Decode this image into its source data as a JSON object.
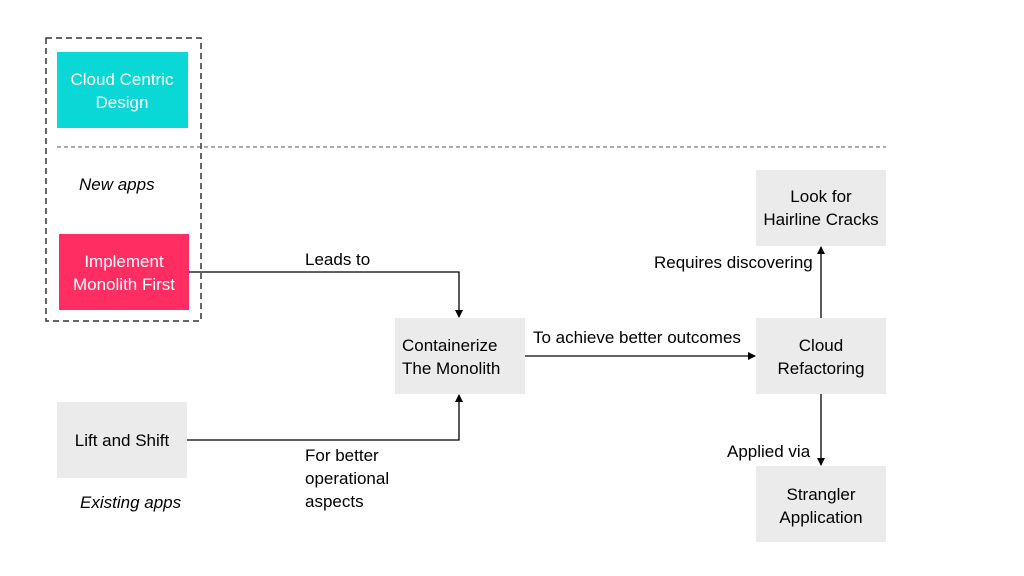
{
  "nodes": {
    "cloud_centric": {
      "lines": [
        "Cloud Centric",
        "Design"
      ],
      "color": "#0ad8d6"
    },
    "implement_monolith": {
      "lines": [
        "Implement",
        "Monolith First"
      ],
      "color": "#ff2d62"
    },
    "containerize": {
      "lines": [
        "Containerize",
        "The Monolith"
      ],
      "color": "#ebebeb"
    },
    "lift_shift": {
      "lines": [
        "Lift and Shift"
      ],
      "color": "#ebebeb"
    },
    "cloud_refactoring": {
      "lines": [
        "Cloud",
        "Refactoring"
      ],
      "color": "#ebebeb"
    },
    "hairline": {
      "lines": [
        "Look for",
        "Hairline Cracks"
      ],
      "color": "#ebebeb"
    },
    "strangler": {
      "lines": [
        "Strangler",
        "Application"
      ],
      "color": "#ebebeb"
    }
  },
  "section_labels": {
    "new_apps": "New apps",
    "existing_apps": "Existing apps"
  },
  "edges": {
    "leads_to": "Leads to",
    "better_outcomes": "To achieve better outcomes",
    "operational": [
      "For better",
      "operational",
      "aspects"
    ],
    "requires": "Requires discovering",
    "applied_via": "Applied via"
  }
}
